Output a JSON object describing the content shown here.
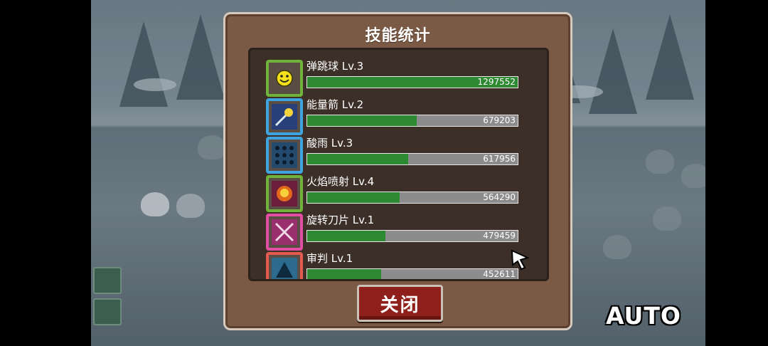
{
  "panel": {
    "title": "技能统计",
    "close_label": "关闭"
  },
  "skills": [
    {
      "name": "弹跳球 Lv.3",
      "value": "1297552",
      "fill": 1.0,
      "border": "#6fb33a",
      "icon": "smiley-ball-icon",
      "icon_color": "#f2e11c"
    },
    {
      "name": "能量箭 Lv.2",
      "value": "679203",
      "fill": 0.52,
      "border": "#3ea4e0",
      "icon": "energy-arrow-icon",
      "icon_color": "#3b5fb0"
    },
    {
      "name": "酸雨 Lv.3",
      "value": "617956",
      "fill": 0.48,
      "border": "#3ea4e0",
      "icon": "acid-rain-icon",
      "icon_color": "#2c5f8a"
    },
    {
      "name": "火焰喷射 Lv.4",
      "value": "564290",
      "fill": 0.44,
      "border": "#6fb33a",
      "icon": "flame-thrower-icon",
      "icon_color": "#e06a1a"
    },
    {
      "name": "旋转刀片 Lv.1",
      "value": "479459",
      "fill": 0.37,
      "border": "#e24fa2",
      "icon": "spinning-blade-icon",
      "icon_color": "#b23a7e"
    },
    {
      "name": "审判 Lv.1",
      "value": "452611",
      "fill": 0.35,
      "border": "#e45a4e",
      "icon": "judgment-icon",
      "icon_color": "#2c6a8e"
    }
  ],
  "hud": {
    "auto_label": "AUTO"
  }
}
